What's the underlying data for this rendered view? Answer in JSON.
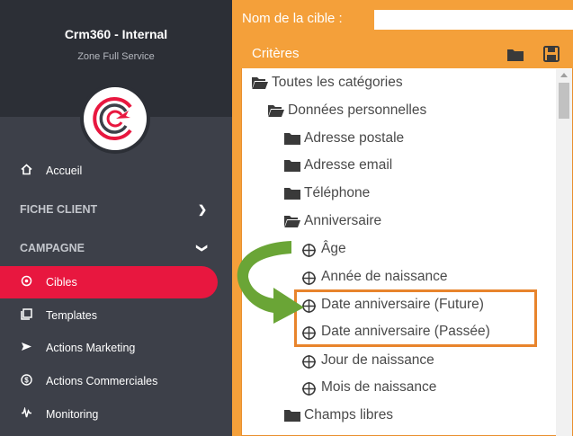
{
  "sidebar": {
    "app_title": "Crm360 - Internal",
    "app_subtitle": "Zone Full Service",
    "items": [
      {
        "label": "Accueil",
        "icon": "home-icon"
      },
      {
        "label": "FICHE CLIENT",
        "icon": "chevron-right-icon",
        "section": true
      },
      {
        "label": "CAMPAGNE",
        "icon": "chevron-down-icon",
        "section": true
      },
      {
        "label": "Cibles",
        "icon": "target-icon",
        "active": true
      },
      {
        "label": "Templates",
        "icon": "template-icon"
      },
      {
        "label": "Actions Marketing",
        "icon": "send-icon"
      },
      {
        "label": "Actions Commerciales",
        "icon": "dollar-icon"
      },
      {
        "label": "Monitoring",
        "icon": "monitoring-icon"
      }
    ],
    "active_color": "#e8173f"
  },
  "target_form": {
    "label": "Nom de la cible :",
    "value": ""
  },
  "criteria_panel": {
    "title": "Critères",
    "tree": [
      {
        "label": "Toutes les catégories",
        "type": "folder-open"
      },
      {
        "label": "Données personnelles",
        "type": "folder-open"
      },
      {
        "label": "Adresse postale",
        "type": "folder"
      },
      {
        "label": "Adresse email",
        "type": "folder"
      },
      {
        "label": "Téléphone",
        "type": "folder"
      },
      {
        "label": "Anniversaire",
        "type": "folder-open"
      },
      {
        "label": "Âge",
        "type": "criterion"
      },
      {
        "label": "Année de naissance",
        "type": "criterion"
      },
      {
        "label": "Date anniversaire (Future)",
        "type": "criterion",
        "highlighted": true
      },
      {
        "label": "Date anniversaire (Passée)",
        "type": "criterion",
        "highlighted": true
      },
      {
        "label": "Jour de naissance",
        "type": "criterion"
      },
      {
        "label": "Mois de naissance",
        "type": "criterion"
      },
      {
        "label": "Champs libres",
        "type": "folder"
      }
    ]
  },
  "colors": {
    "accent": "#f4a03a",
    "highlight_border": "#e8842c",
    "arrow": "#6aa536",
    "sidebar_bg": "#3d4049"
  }
}
